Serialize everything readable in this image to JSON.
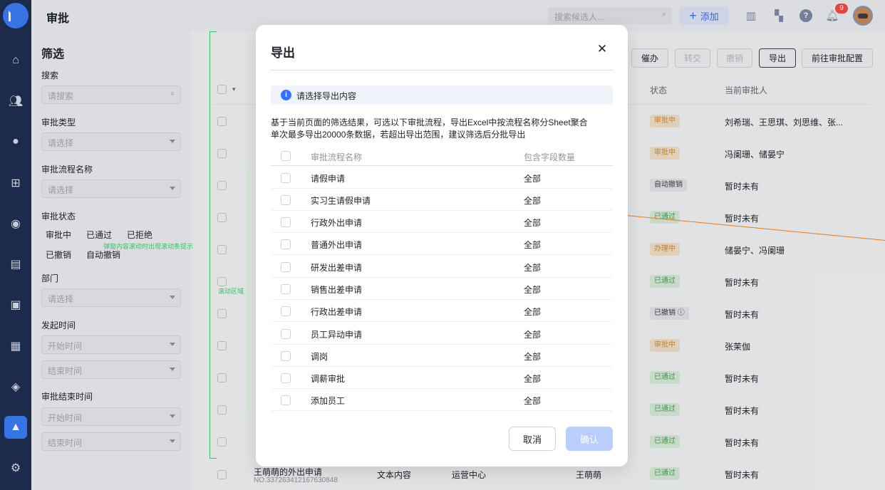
{
  "app": {
    "title": "审批",
    "search_placeholder": "搜索候选人...",
    "add_label": "添加",
    "notification_count": "9",
    "nav_icons": [
      "home-icon",
      "team-icon",
      "person-icon",
      "org-chart-icon",
      "person-settings-icon",
      "calendar-icon",
      "ticket-icon",
      "report-icon",
      "package-icon",
      "approval-icon",
      "settings-icon"
    ]
  },
  "filter": {
    "title": "筛选",
    "search_label": "搜索",
    "search_placeholder": "请搜索",
    "type_label": "审批类型",
    "type_placeholder": "请选择",
    "flow_label": "审批流程名称",
    "flow_placeholder": "请选择",
    "status_label": "审批状态",
    "status_options": [
      "审批中",
      "已通过",
      "已拒绝",
      "已撤销",
      "自动撤销"
    ],
    "dept_label": "部门",
    "dept_placeholder": "请选择",
    "start_label": "发起时间",
    "start_from": "开始时间",
    "start_to": "结束时间",
    "end_label": "审批结束时间",
    "end_from": "开始时间",
    "end_to": "结束时间"
  },
  "table": {
    "actions": [
      "催办",
      "转交",
      "撤销",
      "导出",
      "前往审批配置"
    ],
    "col_status": "状态",
    "col_approver": "当前审批人",
    "rows": [
      {
        "status": "审批中",
        "approver": "刘希瑞、王思琪、刘思维、张..."
      },
      {
        "status": "审批中",
        "approver": "冯阑珊、储晏宁"
      },
      {
        "status": "自动撤销",
        "approver": "暂时未有"
      },
      {
        "status": "已通过",
        "approver": "暂时未有"
      },
      {
        "status": "办理中",
        "approver": "储晏宁、冯阑珊"
      },
      {
        "status": "已通过",
        "approver": "暂时未有"
      },
      {
        "status": "已撤销",
        "approver": "暂时未有"
      },
      {
        "status": "审批中",
        "approver": "张茉伽"
      },
      {
        "status": "已通过",
        "approver": "暂时未有"
      },
      {
        "status": "已通过",
        "approver": "暂时未有"
      },
      {
        "status": "已通过",
        "approver": "暂时未有"
      },
      {
        "status": "已通过",
        "approver": "暂时未有"
      }
    ],
    "last_row": {
      "title": "王萌萌的外出申请",
      "number": "NO.337263412167630848",
      "type": "文本内容",
      "dept": "运营中心",
      "applicant": "王萌萌"
    }
  },
  "guides": {
    "label_a": "弹窗内容滚动时出现滚动条提示",
    "label_b": "滚动区域"
  },
  "modal": {
    "title": "导出",
    "info": "请选择导出内容",
    "desc_line1": "基于当前页面的筛选结果，可选以下审批流程，导出Excel中按流程名称分Sheet聚合",
    "desc_line2": "单次最多导出20000条数据，若超出导出范围，建议筛选后分批导出",
    "col_name": "审批流程名称",
    "col_count": "包含字段数量",
    "flows": [
      {
        "name": "请假申请",
        "count": "全部"
      },
      {
        "name": "实习生请假申请",
        "count": "全部"
      },
      {
        "name": "行政外出申请",
        "count": "全部"
      },
      {
        "name": "普通外出申请",
        "count": "全部"
      },
      {
        "name": "研发出差申请",
        "count": "全部"
      },
      {
        "name": "销售出差申请",
        "count": "全部"
      },
      {
        "name": "行政出差申请",
        "count": "全部"
      },
      {
        "name": "员工异动申请",
        "count": "全部"
      },
      {
        "name": "调岗",
        "count": "全部"
      },
      {
        "name": "调薪审批",
        "count": "全部"
      },
      {
        "name": "添加员工",
        "count": "全部"
      }
    ],
    "cancel": "取消",
    "confirm": "确认"
  }
}
